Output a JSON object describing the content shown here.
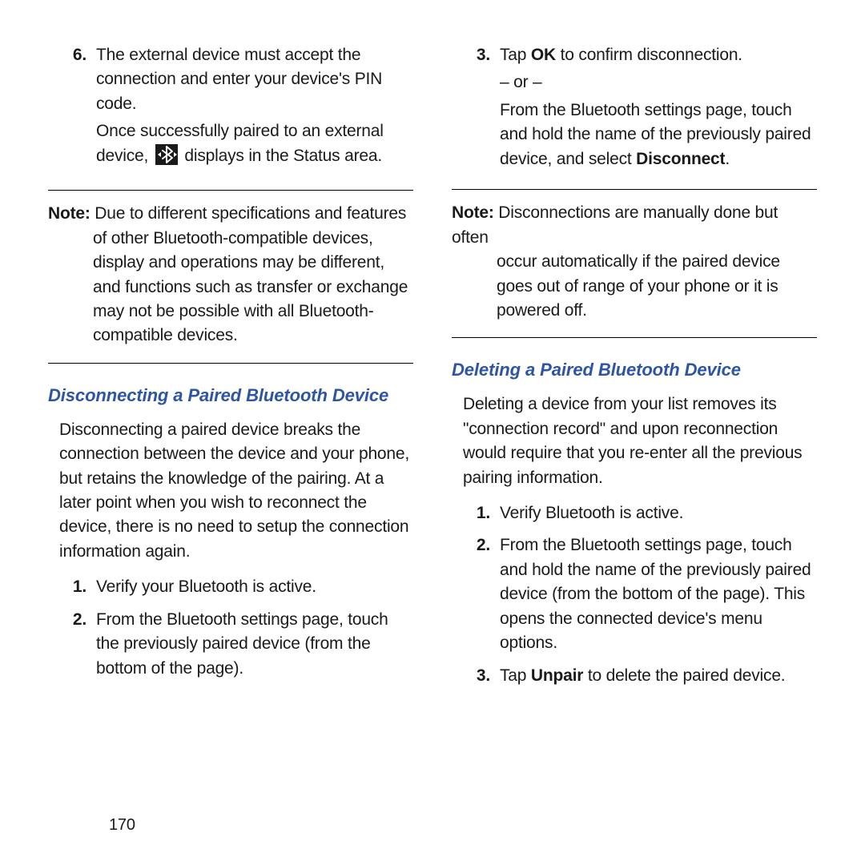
{
  "page_number": "170",
  "left": {
    "item6_num": "6.",
    "item6a": "The external device must accept the connection and enter your device's PIN code.",
    "item6b_pre": "Once successfully paired to an external device, ",
    "item6b_post": " displays in the Status area.",
    "note_label": "Note:",
    "note_first": " Due to different specifications and features",
    "note_rest": "of other Bluetooth-compatible devices, display and operations may be different, and functions such as transfer or exchange may not be possible with all Bluetooth-compatible devices.",
    "heading": "Disconnecting a Paired Bluetooth Device",
    "intro": "Disconnecting a paired device breaks the connection between the device and your phone, but retains the knowledge of the pairing. At a later point when you wish to reconnect the device, there is no need to setup the connection information again.",
    "s1_num": "1.",
    "s1": "Verify your Bluetooth is active.",
    "s2_num": "2.",
    "s2": "From the Bluetooth settings page, touch the previously paired device (from the bottom of the page)."
  },
  "right": {
    "s3_num": "3.",
    "s3a_pre": "Tap ",
    "s3a_bold": "OK",
    "s3a_post": "  to confirm disconnection.",
    "s3_or": "– or –",
    "s3b_pre": "From the Bluetooth settings page, touch and hold the name of the previously paired device, and select ",
    "s3b_bold": "Disconnect",
    "s3b_post": ".",
    "note_label": "Note:",
    "note_first": " Disconnections are manually done but often",
    "note_rest": "occur automatically if the paired device goes out of range of your phone or it is powered off.",
    "heading": "Deleting a Paired Bluetooth Device",
    "intro": "Deleting a device from your list removes its \"connection record\" and upon reconnection would require that you re-enter all the previous pairing information.",
    "d1_num": "1.",
    "d1": "Verify Bluetooth is active.",
    "d2_num": "2.",
    "d2": "From the Bluetooth settings page, touch and hold the name of the previously paired device (from the bottom of the page). This opens the connected device's menu options.",
    "d3_num": "3.",
    "d3_pre": "Tap ",
    "d3_bold": "Unpair",
    "d3_post": " to delete the paired device."
  }
}
